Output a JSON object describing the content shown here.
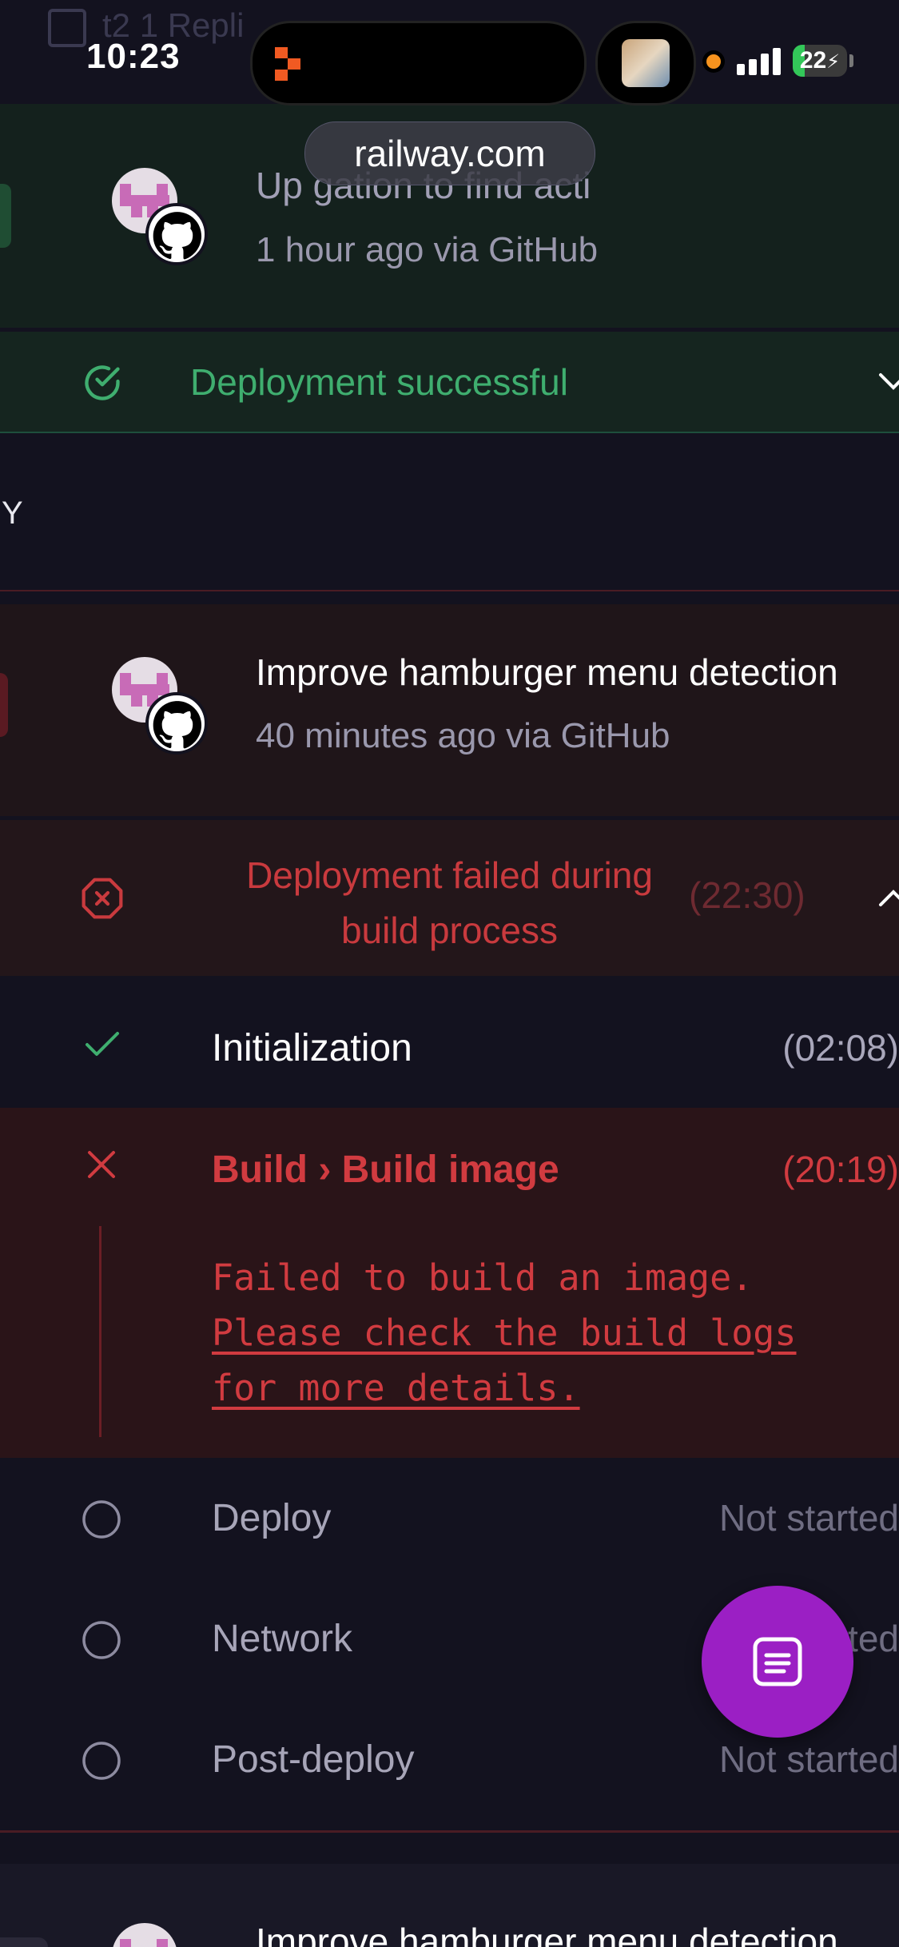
{
  "status_bar": {
    "time": "10:23",
    "battery": "22",
    "battery_level": 0.22,
    "ghost_text": "t2     1 Repli"
  },
  "browser": {
    "url": "railway.com"
  },
  "deployments": [
    {
      "commit_title": "Update navigation to find actions",
      "commit_title_visible": "Up          gation to find acti",
      "meta": "1 hour ago via GitHub",
      "status": "Deployment successful"
    },
    {
      "label": "Y"
    },
    {
      "commit_title": "Improve hamburger menu detection",
      "meta": "40 minutes ago via GitHub",
      "status_line1": "Deployment failed during",
      "status_line2": "build process",
      "duration": "(22:30)"
    }
  ],
  "steps": [
    {
      "name": "Initialization",
      "duration": "(02:08)",
      "state": "done"
    },
    {
      "name": "Build › Build image",
      "duration": "(20:19)",
      "state": "failed",
      "error_line1": "Failed to build an image.",
      "error_line2": "Please check the build logs ",
      "error_line3": "for more details."
    },
    {
      "name": "Deploy",
      "duration": "Not started",
      "state": "pending"
    },
    {
      "name": "Network",
      "duration": "Not started",
      "state": "pending"
    },
    {
      "name": "Post-deploy",
      "duration": "Not started",
      "state": "pending"
    }
  ],
  "next_deployment": {
    "commit_title": "Improve hamburger menu detection"
  },
  "colors": {
    "success": "#3fae6f",
    "error": "#d13b40",
    "fab": "#9b1fc4",
    "background": "#13121f"
  },
  "icons": {
    "success_status": "check-circle-icon",
    "failed_status": "x-circle-icon",
    "step_done": "check-icon",
    "step_failed": "x-icon",
    "step_pending": "circle-icon",
    "fab": "logs-icon",
    "source": "github-icon"
  }
}
